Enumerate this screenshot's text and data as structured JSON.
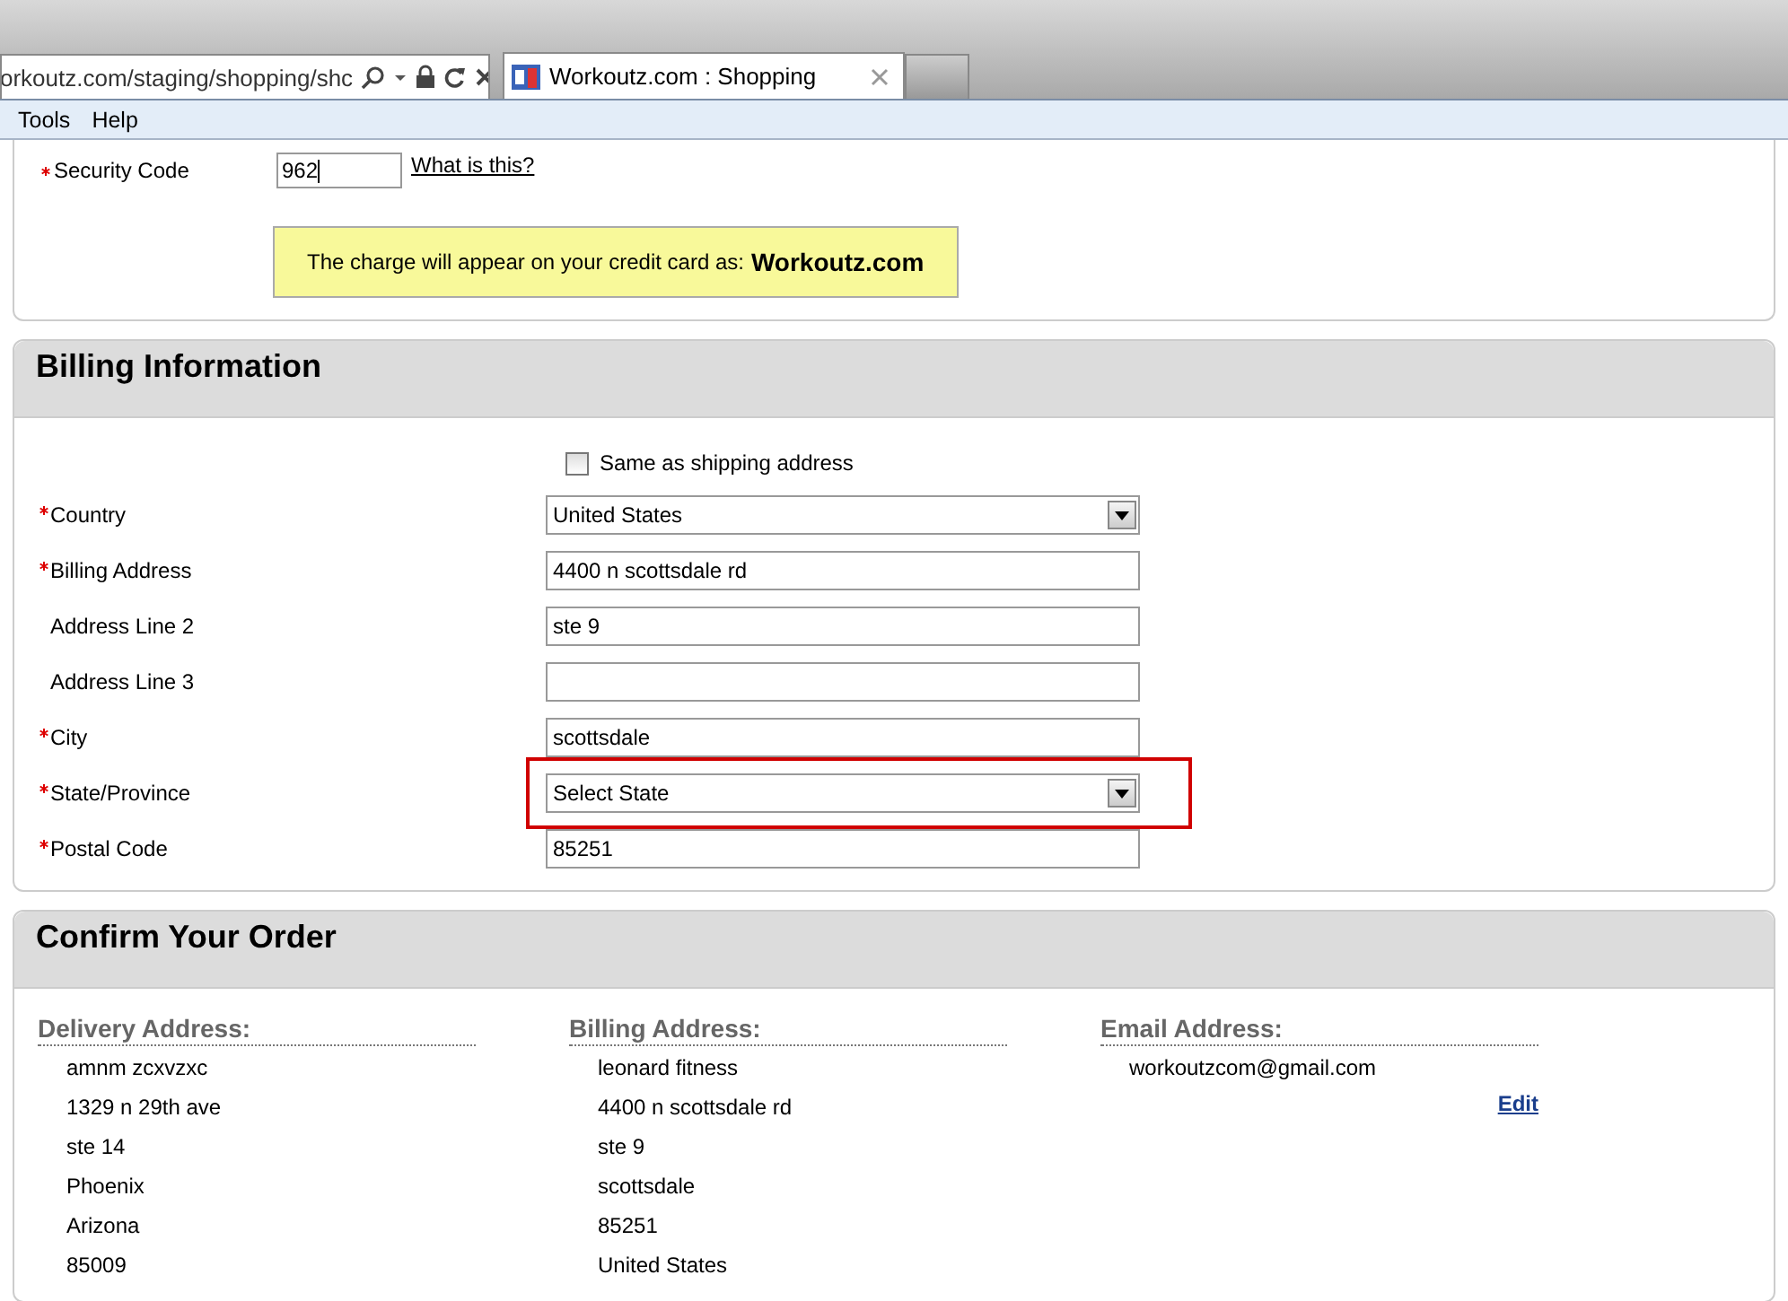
{
  "browser": {
    "address": "orkoutz.com/staging/shopping/shc",
    "tab": {
      "title": "Workoutz.com : Shopping",
      "selected": true
    }
  },
  "menu": [
    "Tools",
    "Help"
  ],
  "payment": {
    "security_label": "Security Code",
    "required": true,
    "security_value": "962",
    "help_link": "What is this?",
    "notice": "The charge will appear on your credit card as: **Workoutz.com**"
  },
  "billing": {
    "title": "Billing Information",
    "same_as_shipping": {
      "label": "Same as shipping address",
      "checked": false
    },
    "fields": [
      {
        "label": "Country",
        "required": true,
        "kind": "select",
        "value": "United States",
        "highlighted": false
      },
      {
        "label": "Billing Address",
        "required": true,
        "kind": "text",
        "value": "4400 n scottsdale rd",
        "highlighted": false
      },
      {
        "label": "Address Line 2",
        "required": false,
        "kind": "text",
        "value": "ste 9",
        "highlighted": false
      },
      {
        "label": "Address Line 3",
        "required": false,
        "kind": "text",
        "highlighted": false
      },
      {
        "label": "City",
        "required": true,
        "kind": "text",
        "value": "scottsdale",
        "highlighted": false
      },
      {
        "label": "State/Province",
        "required": true,
        "kind": "select",
        "value": "Select State",
        "highlighted": true
      },
      {
        "label": "Postal Code",
        "required": true,
        "kind": "text",
        "value": "85251",
        "highlighted": false
      }
    ]
  },
  "confirm": {
    "title": "Confirm Your Order",
    "columns": [
      {
        "heading": "Delivery Address:",
        "lines": [
          "amnm zcxvzxc",
          "1329 n 29th ave",
          "ste 14",
          "Phoenix",
          "Arizona",
          "85009"
        ]
      },
      {
        "heading": "Billing Address:",
        "lines": [
          "leonard fitness",
          "4400 n scottsdale rd",
          "ste 9",
          "scottsdale",
          "85251",
          "United States"
        ]
      },
      {
        "heading": "Email Address:",
        "lines": [
          "workoutzcom@gmail.com"
        ],
        "edit_link": "Edit"
      }
    ]
  }
}
